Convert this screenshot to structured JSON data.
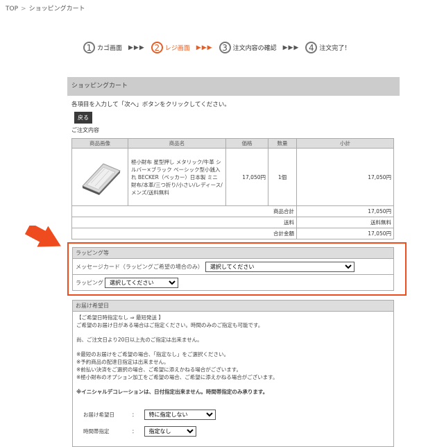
{
  "breadcrumb": {
    "top": "TOP",
    "sep": ">",
    "current": "ショッピングカート"
  },
  "steps": [
    {
      "num": "1",
      "label": "カゴ画面"
    },
    {
      "num": "2",
      "label": "レジ画面"
    },
    {
      "num": "3",
      "label": "注文内容の確認"
    },
    {
      "num": "4",
      "label": "注文完了！"
    }
  ],
  "arrows": "▶▶▶",
  "panel": {
    "title": "ショッピングカート",
    "instruction": "各項目を入力して「次へ」ボタンをクリックしてください。",
    "back_label": "戻る",
    "order_title": "ご注文内容"
  },
  "table": {
    "headers": [
      "商品画像",
      "商品名",
      "価格",
      "数量",
      "小計"
    ],
    "item": {
      "name": "極小財布 星型押し メタリック/牛革 シルバー×ブラック ベーシック型小銭入れ BECKER（ベッカー）日本製 ミニ財布/本革/三つ折り/小さい/レディース/メンズ/送料無料",
      "price": "17,050円",
      "qty": "1個",
      "subtotal": "17,050円"
    },
    "totals": [
      {
        "label": "商品合計",
        "value": "17,050円"
      },
      {
        "label": "送料",
        "value": "送料無料"
      },
      {
        "label": "合計金額",
        "value": "17,050円"
      }
    ]
  },
  "wrapping": {
    "title": "ラッピング等",
    "message_label": "メッセージカード（ラッピングご希望の場合のみ）",
    "message_value": "選択してください",
    "wrap_label": "ラッピング",
    "wrap_value": "選択してください"
  },
  "delivery": {
    "title": "お届け希望日",
    "lines": [
      "【ご希望日時指定なし ⇒ 最短発送 】",
      "ご希望のお届け日がある場合はご指定ください。時間のみのご指定も可能です。",
      "",
      "尚、ご注文日より20日以上先のご指定は出来ません。",
      "",
      "※最短のお届けをご希望の場合、「指定なし」をご選択ください。",
      "※予約商品の配達日指定は出来ません。",
      "※前払い決済をご選択の場合、ご希望に添えかねる場合がございます。",
      "※極小財布のオプション加工をご希望の場合、ご希望に添えかねる場合がございます。",
      "",
      "※イニシャルデコレーションは、日付指定出来ません。時間帯指定のみ承ります。"
    ],
    "date_label": "お届け希望日",
    "date_value": "特に指定しない",
    "time_label": "時間帯指定",
    "time_value": "指定なし",
    "colon": "："
  },
  "colors": {
    "accent": "#e85d24",
    "frame": "#ee4b1e"
  }
}
